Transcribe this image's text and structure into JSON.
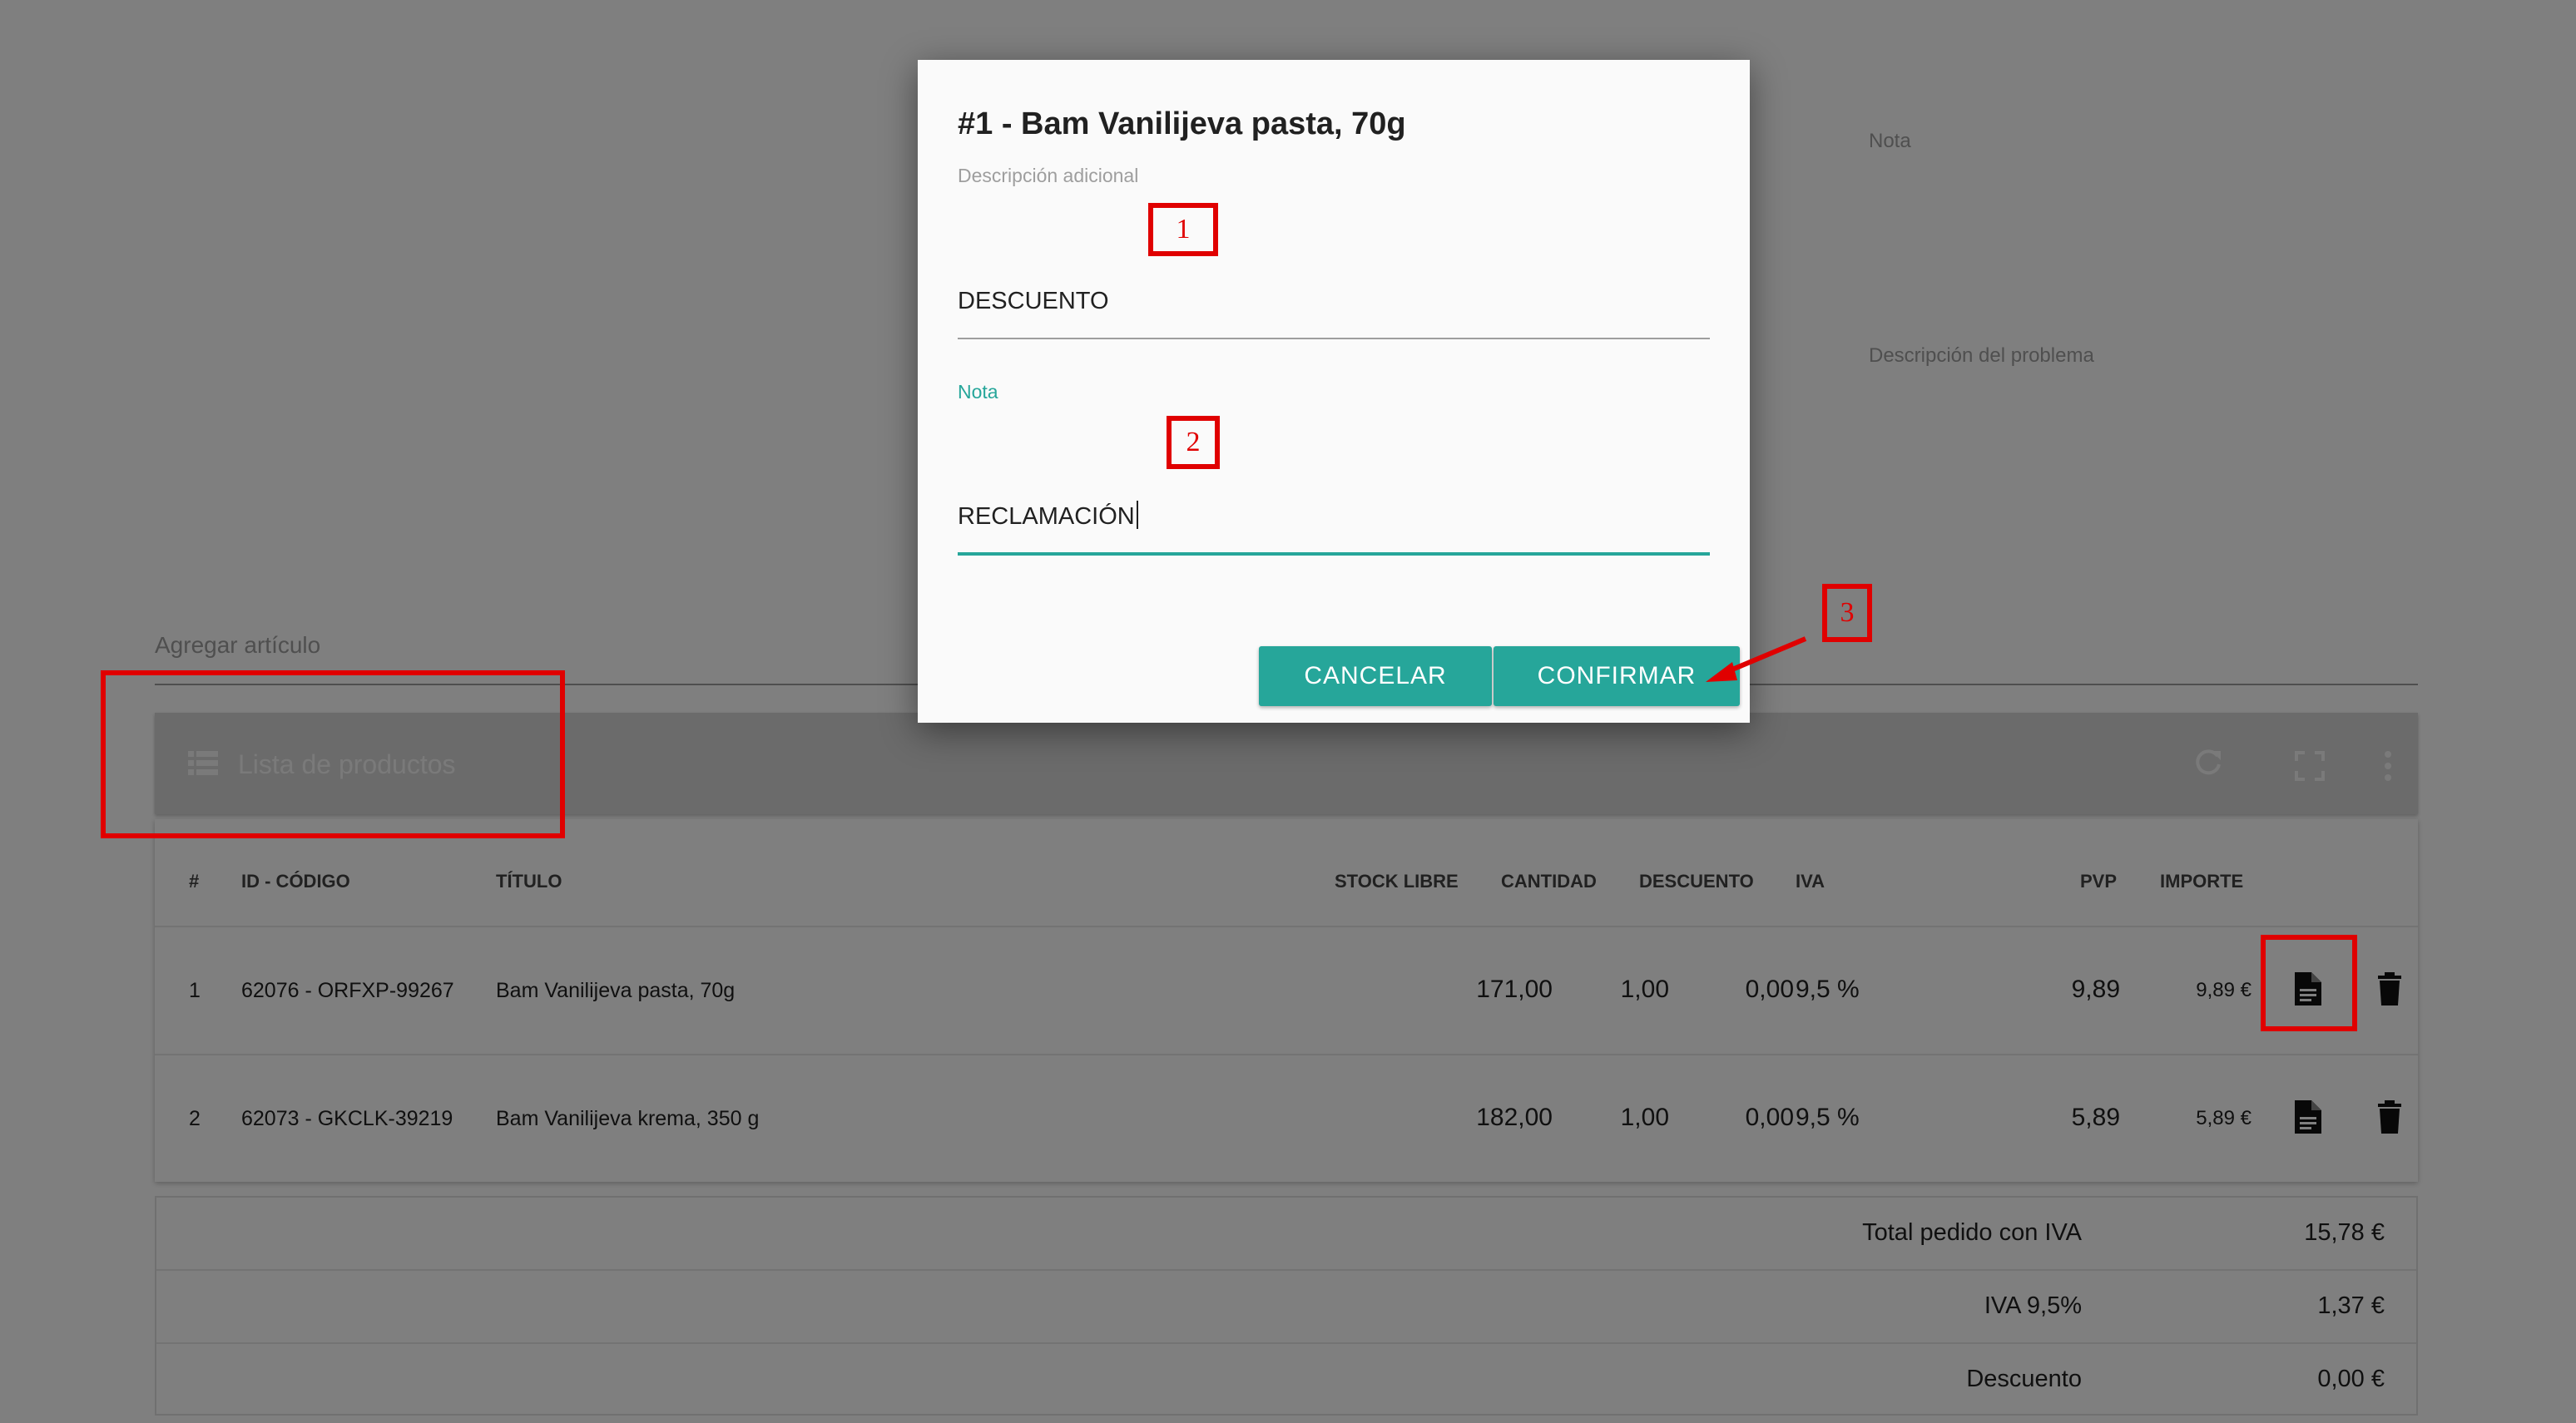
{
  "background": {
    "side_fields": {
      "nota_label": "Nota",
      "problema_label": "Descripción del problema"
    },
    "add_item": {
      "placeholder": "Agregar artículo"
    },
    "panel": {
      "title": "Lista de productos",
      "icons": [
        "list-icon",
        "refresh-icon",
        "fullscreen-icon",
        "more-vert-icon"
      ]
    },
    "table": {
      "headers": {
        "num": "#",
        "id": "ID - CÓDIGO",
        "title": "TÍTULO",
        "stock": "STOCK LIBRE",
        "qty": "CANTIDAD",
        "discount": "DESCUENTO",
        "vat": "IVA",
        "pvp": "PVP",
        "amount": "IMPORTE"
      },
      "rows": [
        {
          "num": "1",
          "id": "62076 - ORFXP-99267",
          "title": "Bam Vanilijeva pasta, 70g",
          "stock": "171,00",
          "qty": "1,00",
          "discount": "0,00",
          "vat": "9,5 %",
          "pvp": "9,89",
          "amount": "9,89 €"
        },
        {
          "num": "2",
          "id": "62073 - GKCLK-39219",
          "title": "Bam Vanilijeva krema, 350 g",
          "stock": "182,00",
          "qty": "1,00",
          "discount": "0,00",
          "vat": "9,5 %",
          "pvp": "5,89",
          "amount": "5,89 €"
        }
      ],
      "row_icons": [
        "document-icon",
        "delete-icon"
      ]
    },
    "totals": [
      {
        "label": "Total pedido con IVA",
        "value": "15,78 €"
      },
      {
        "label": "IVA 9,5%",
        "value": "1,37 €"
      },
      {
        "label": "Descuento",
        "value": "0,00 €"
      }
    ]
  },
  "dialog": {
    "title": "#1 - Bam Vanilijeva pasta, 70g",
    "field1": {
      "label": "Descripción adicional",
      "value": "DESCUENTO"
    },
    "field2": {
      "label": "Nota",
      "value": "RECLAMACIÓN"
    },
    "buttons": {
      "cancel": "CANCELAR",
      "confirm": "CONFIRMAR"
    }
  },
  "annotations": {
    "marker1": "1",
    "marker2": "2",
    "marker3": "3",
    "color": "#e00000"
  },
  "colors": {
    "accent": "#26a69a",
    "overlay": "rgba(0,0,0,0.5)"
  }
}
